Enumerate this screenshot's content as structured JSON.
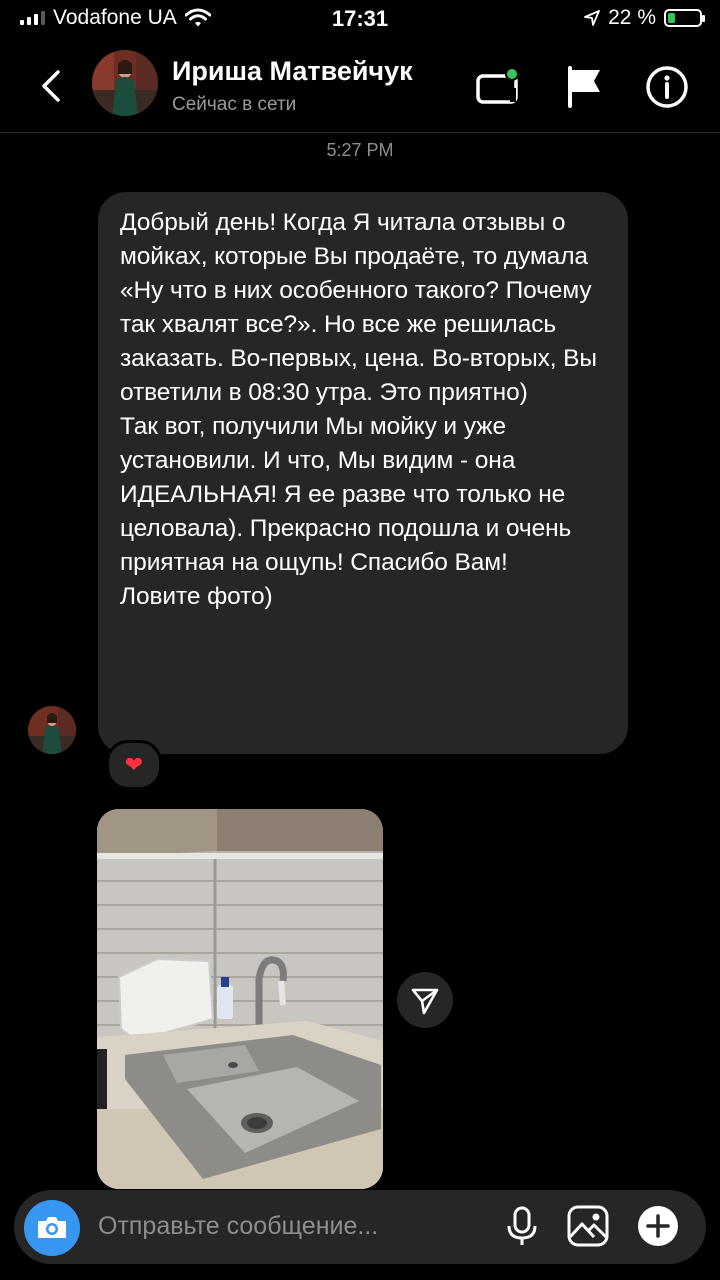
{
  "status_bar": {
    "carrier": "Vodafone UA",
    "time": "17:31",
    "battery_percent": "22 %",
    "battery_level": 0.22
  },
  "header": {
    "contact_name": "Ириша Матвейчук",
    "presence": "Сейчас в сети"
  },
  "thread": {
    "timestamp": "5:27 PM",
    "message_paragraphs": [
      "Добрый день! Когда Я читала отзывы о мойках, которые Вы продаёте, то думала «Ну что в них особенного такого? Почему так хвалят все?». Но все же решилась заказать. Во-первых, цена. Во-вторых, Вы ответили в 08:30 утра. Это приятно)",
      "Так вот, получили Мы мойку и уже установили. И что, Мы видим - она ИДЕАЛЬНАЯ! Я ее разве что только не целовала). Прекрасно подошла и очень приятная на ощупь! Спасибо Вам!",
      "Ловите фото)"
    ],
    "reaction": "❤",
    "accent_colors": {
      "bubble": "#262626",
      "camera_button": "#3797f0",
      "online_dot": "#34c759"
    }
  },
  "composer": {
    "placeholder": "Отправьте сообщение..."
  },
  "icons": {
    "back": "chevron-left-icon",
    "video": "video-call-icon",
    "flag": "flag-icon",
    "info": "info-icon",
    "camera": "camera-icon",
    "mic": "microphone-icon",
    "gallery": "gallery-icon",
    "plus": "plus-icon",
    "share": "send-icon"
  }
}
